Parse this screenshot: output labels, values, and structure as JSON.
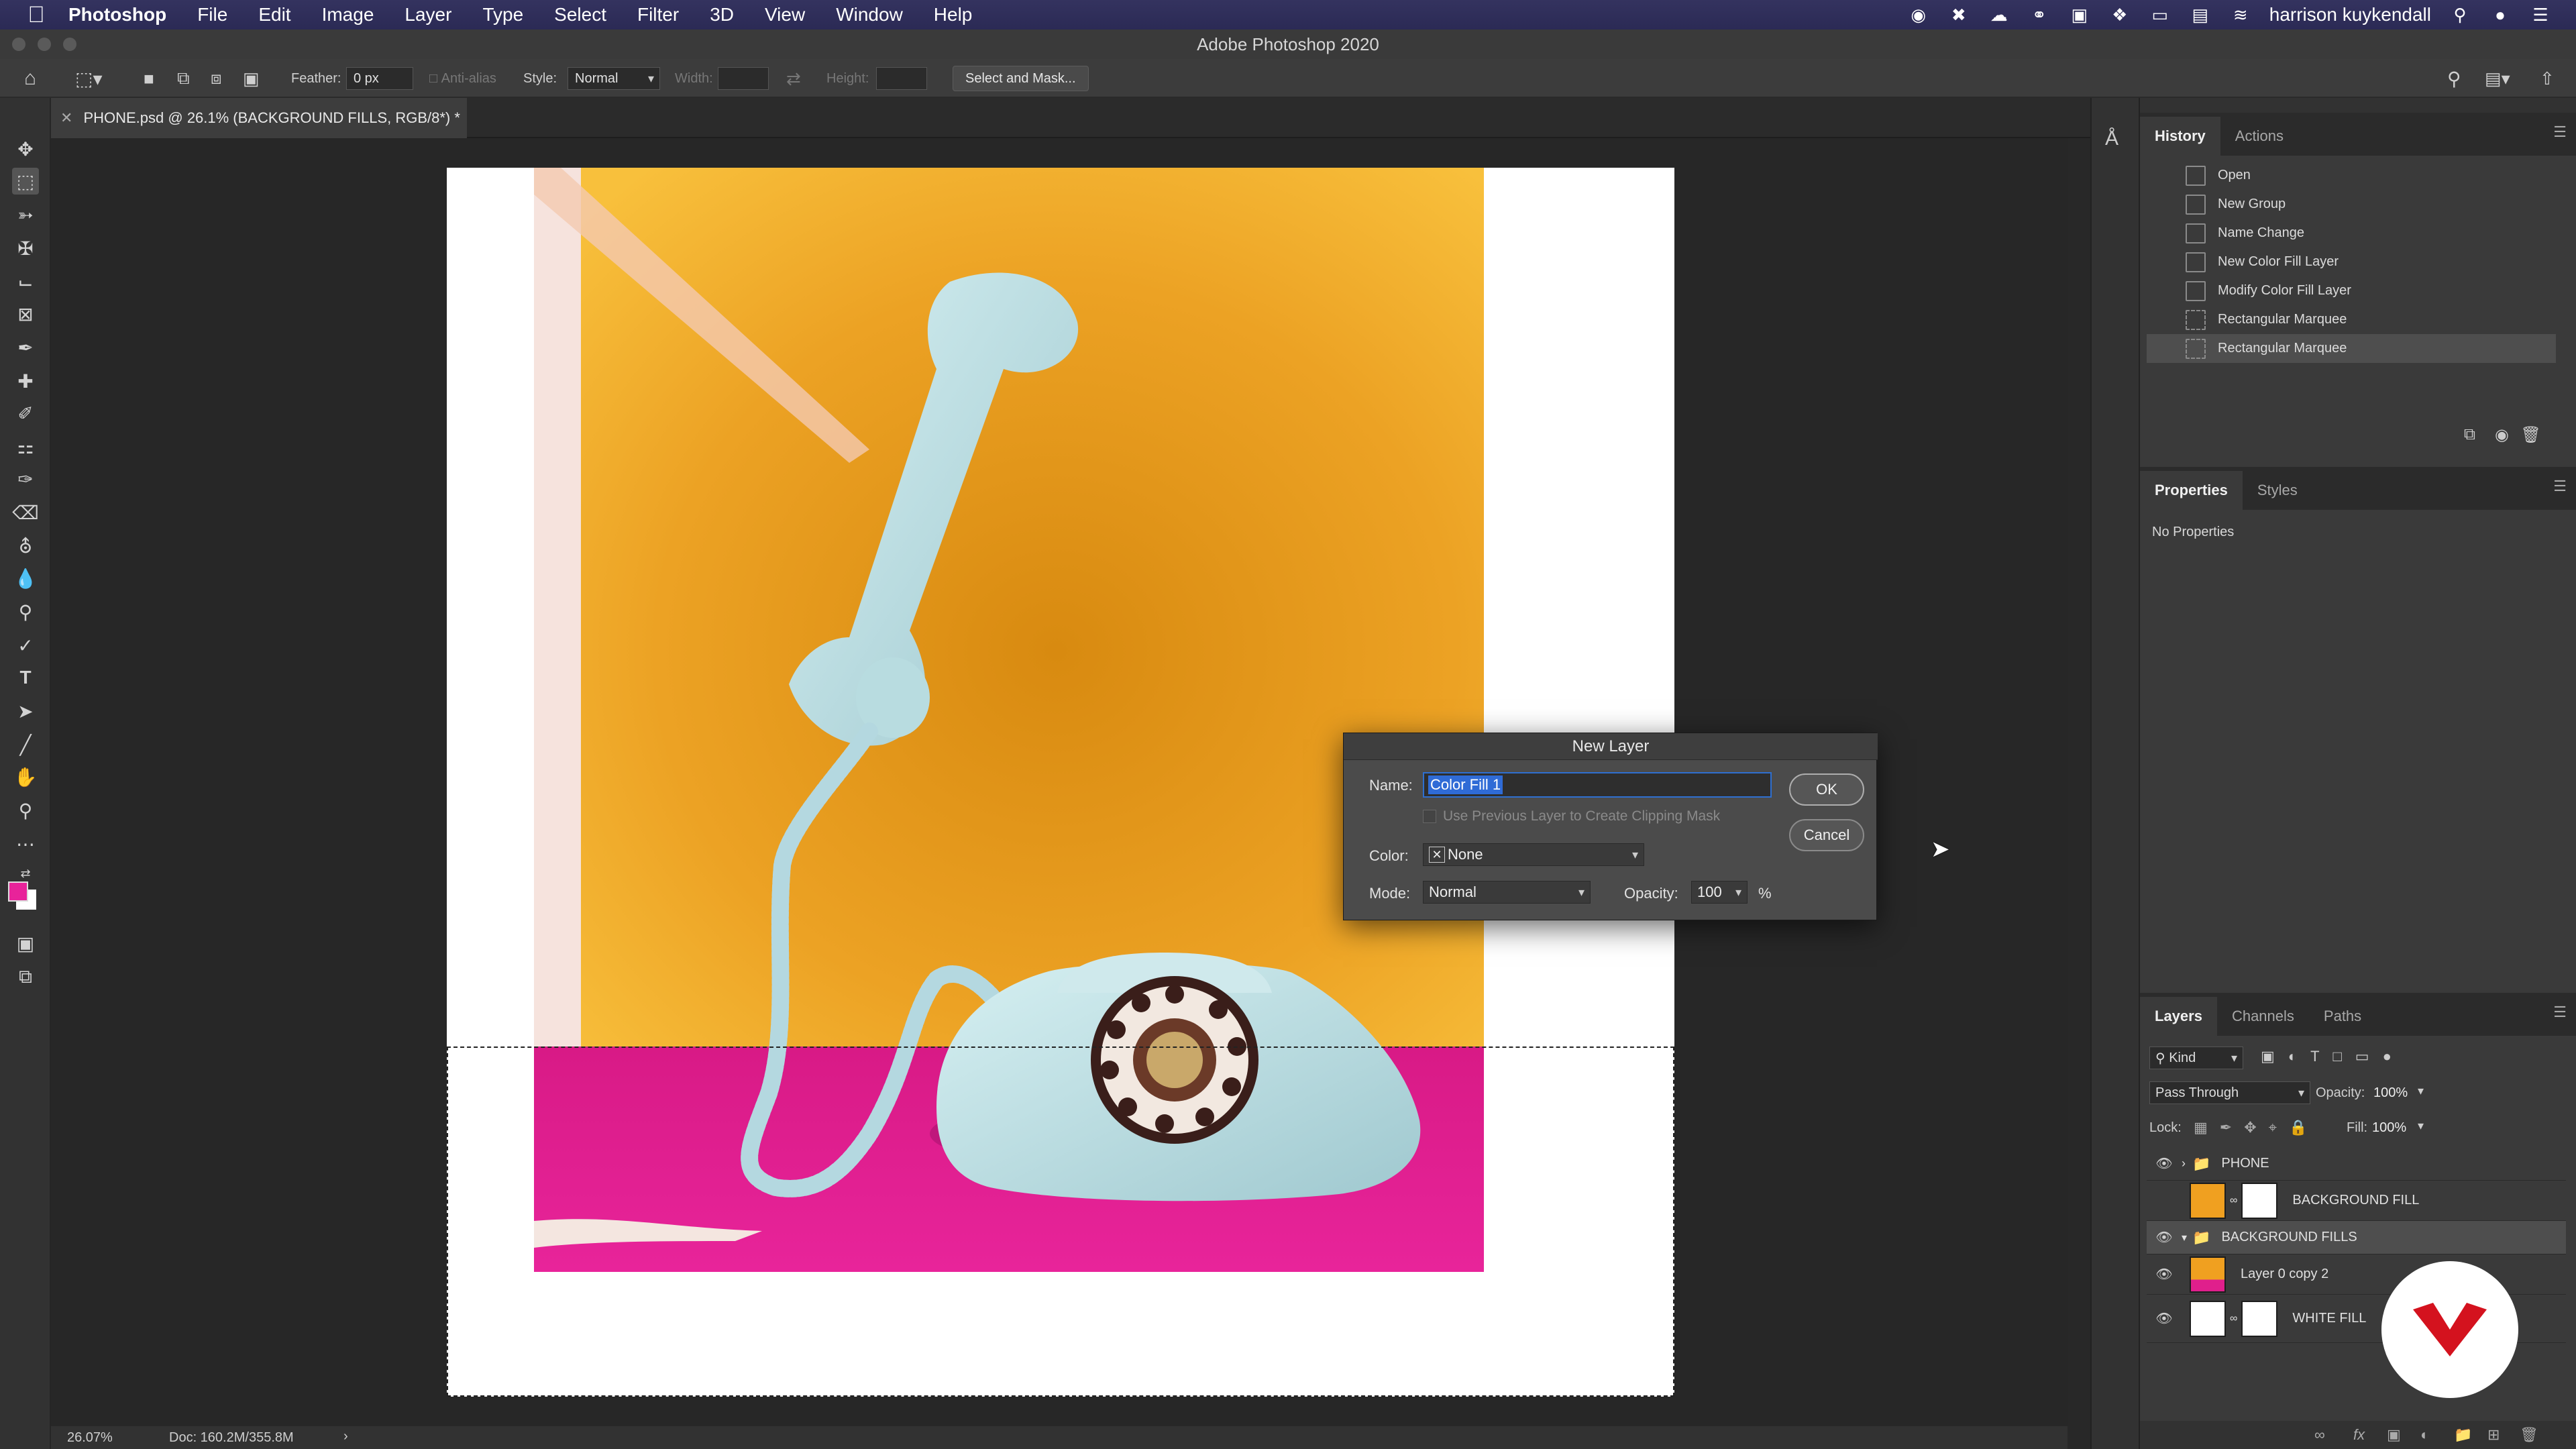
{
  "menubar": {
    "app": "Photoshop",
    "items": [
      "File",
      "Edit",
      "Image",
      "Layer",
      "Type",
      "Select",
      "Filter",
      "3D",
      "View",
      "Window",
      "Help"
    ],
    "user": "harrison kuykendall"
  },
  "window": {
    "title": "Adobe Photoshop 2020"
  },
  "options": {
    "feather_label": "Feather:",
    "feather_value": "0 px",
    "antialias_label": "Anti-alias",
    "style_label": "Style:",
    "style_value": "Normal",
    "width_label": "Width:",
    "height_label": "Height:",
    "select_mask": "Select and Mask..."
  },
  "document": {
    "tab_title": "PHONE.psd @ 26.1% (BACKGROUND FILLS, RGB/8*) *",
    "zoom": "26.07%",
    "doc_info": "Doc: 160.2M/355.8M"
  },
  "history": {
    "tabs": [
      "History",
      "Actions"
    ],
    "items": [
      "Open",
      "New Group",
      "Name Change",
      "New Color Fill Layer",
      "Modify Color Fill Layer",
      "Rectangular Marquee",
      "Rectangular Marquee"
    ]
  },
  "properties": {
    "tabs": [
      "Properties",
      "Styles"
    ],
    "empty": "No Properties"
  },
  "layers": {
    "tabs": [
      "Layers",
      "Channels",
      "Paths"
    ],
    "filter": "Kind",
    "blend": "Pass Through",
    "opacity_label": "Opacity:",
    "opacity": "100%",
    "lock_label": "Lock:",
    "fill_label": "Fill:",
    "fill": "100%",
    "rows": [
      {
        "name": "PHONE"
      },
      {
        "name": "BACKGROUND FILL"
      },
      {
        "name": "BACKGROUND FILLS"
      },
      {
        "name": "Layer 0 copy 2"
      },
      {
        "name": "WHITE FILL"
      }
    ]
  },
  "dialog": {
    "title": "New Layer",
    "name_label": "Name:",
    "name_value": "Color Fill 1",
    "clip_label": "Use Previous Layer to Create Clipping Mask",
    "color_label": "Color:",
    "color_value": "None",
    "mode_label": "Mode:",
    "mode_value": "Normal",
    "opacity_label": "Opacity:",
    "opacity_value": "100",
    "percent": "%",
    "ok": "OK",
    "cancel": "Cancel"
  },
  "colors": {
    "foreground": "#e8239a",
    "background": "#ffffff",
    "accent_orange": "#f0a020",
    "accent_magenta": "#e01f8c"
  }
}
